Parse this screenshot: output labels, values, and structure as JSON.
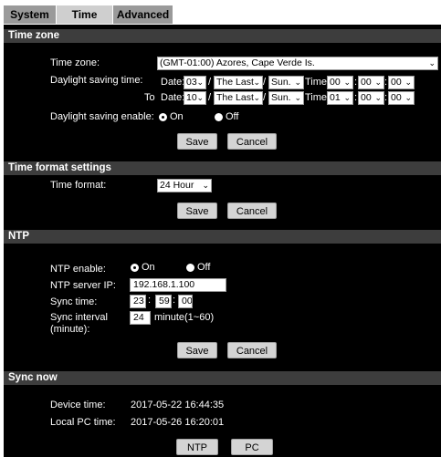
{
  "tabs": [
    {
      "label": "System"
    },
    {
      "label": "Time"
    },
    {
      "label": "Advanced"
    }
  ],
  "timezone": {
    "header": "Time zone",
    "tz_label": "Time zone:",
    "tz_value": "(GMT-01:00) Azores, Cape Verde Is.",
    "dst_label": "Daylight saving time:",
    "date_label": "Date:",
    "time_label": "Time:",
    "to_label": "To",
    "sep": "/",
    "colon": ":",
    "from": {
      "month": "03",
      "week": "The Last",
      "day": "Sun.",
      "hour": "00",
      "minute": "00",
      "second": "00"
    },
    "to": {
      "month": "10",
      "week": "The Last",
      "day": "Sun.",
      "hour": "01",
      "minute": "00",
      "second": "00"
    },
    "dst_enable_label": "Daylight saving enable:",
    "on_label": "On",
    "off_label": "Off",
    "dst_enabled": true,
    "save_label": "Save",
    "cancel_label": "Cancel"
  },
  "format": {
    "header": "Time format settings",
    "format_label": "Time format:",
    "format_value": "24 Hour",
    "save_label": "Save",
    "cancel_label": "Cancel"
  },
  "ntp": {
    "header": "NTP",
    "enable_label": "NTP enable:",
    "on_label": "On",
    "off_label": "Off",
    "enabled": true,
    "server_label": "NTP server IP:",
    "server_value": "192.168.1.100",
    "sync_time_label": "Sync time:",
    "sync_hour": "23",
    "sync_minute": "59",
    "sync_second": "00",
    "colon": ":",
    "interval_label_1": "Sync interval",
    "interval_label_2": "(minute):",
    "interval_value": "24",
    "interval_hint": "minute(1~60)",
    "save_label": "Save",
    "cancel_label": "Cancel"
  },
  "sync": {
    "header": "Sync now",
    "device_label": "Device time:",
    "device_value": "2017-05-22 16:44:35",
    "pc_label": "Local PC time:",
    "pc_value": "2017-05-26 16:20:01",
    "ntp_button": "NTP",
    "pc_button": "PC"
  },
  "icons": {
    "dropdown": "chevron-down-icon",
    "radio": "radio-icon"
  }
}
